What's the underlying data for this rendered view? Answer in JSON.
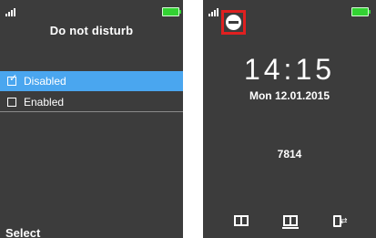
{
  "left_screen": {
    "title": "Do not disturb",
    "options": [
      {
        "label": "Disabled",
        "checked": true,
        "selected": true
      },
      {
        "label": "Enabled",
        "checked": false,
        "selected": false
      }
    ],
    "softkey": "Select"
  },
  "right_screen": {
    "time": "14:15",
    "date": "Mon 12.01.2015",
    "code": "7814",
    "status_icons": [
      "signal-icon",
      "do-not-disturb-icon",
      "battery-icon"
    ],
    "bottom_icons": [
      "contacts-book-icon",
      "messages-book-icon",
      "menu-icon"
    ]
  },
  "colors": {
    "screen_background": "#3c3c3c",
    "selection": "#4aa6ef",
    "battery": "#33d233",
    "highlight_box": "#e02020"
  }
}
